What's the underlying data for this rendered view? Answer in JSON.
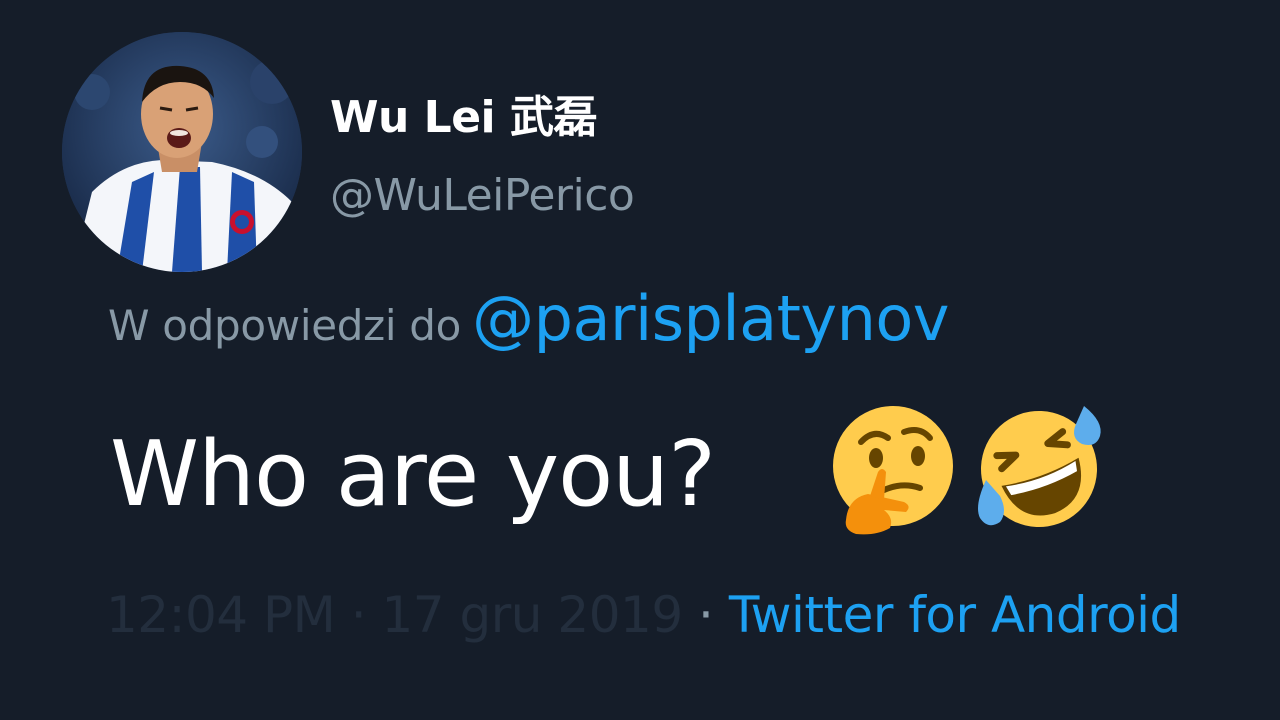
{
  "author": {
    "display_name": "Wu Lei 武磊",
    "handle": "@WuLeiPerico",
    "avatar_icon": "profile-photo"
  },
  "reply": {
    "prefix": "W odpowiedzi do",
    "target": "@parisplatynov"
  },
  "tweet": {
    "text": "Who are you?",
    "emojis": [
      "thinking-face-icon",
      "rofl-face-icon"
    ]
  },
  "meta": {
    "time": "12:04 PM",
    "separator": "·",
    "date": "17 gru 2019",
    "source": "Twitter for Android"
  },
  "colors": {
    "background": "#151d29",
    "text_primary": "#ffffff",
    "text_secondary": "#8899a6",
    "accent": "#1da1f2",
    "faded": "#232e3d"
  }
}
